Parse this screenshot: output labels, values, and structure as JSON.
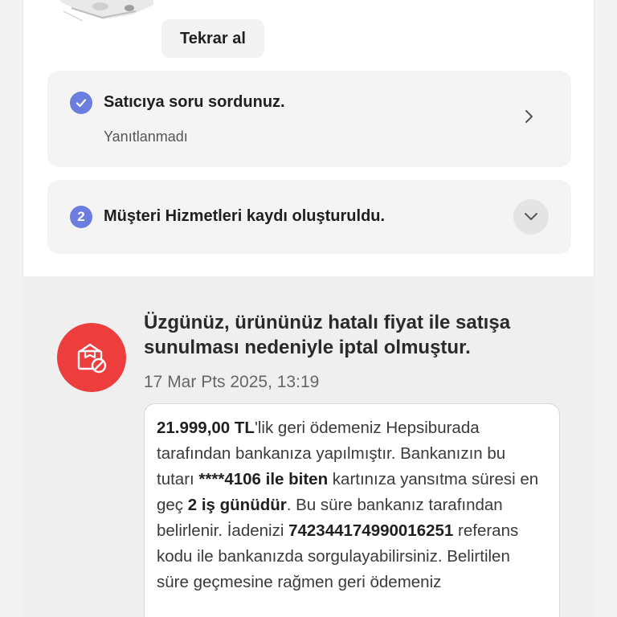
{
  "product": {
    "retake_label": "Tekrar al"
  },
  "steps": [
    {
      "badge": "✓",
      "title": "Satıcıya soru sordunuz.",
      "subtitle": "Yanıtlanmadı"
    },
    {
      "badge": "2",
      "title": "Müşteri Hizmetleri kaydı oluşturuldu."
    }
  ],
  "notice": {
    "title": "Üzgünüz, ürününüz hatalı fiyat ile satışa sunulması nedeniyle iptal olmuştur.",
    "date": "17 Mar Pts 2025, 13:19",
    "message": {
      "amount": "21.999,00 TL",
      "part1": "'lik geri ödemeniz Hepsiburada tarafından bankanıza yapılmıştır. Bankanızın bu tutarı ",
      "card": "****4106 ile biten",
      "part2": " kartınıza yansıtma süresi en geç ",
      "duration": "2 iş günüdür",
      "part3": ". Bu süre bankanız tarafından belirlenir. İadenizi ",
      "reference": "742344174990016251",
      "part4": " referans kodu ile bankanızda sorgulayabilirsiniz. Belirtilen süre geçmesine rağmen geri ödemeniz"
    }
  },
  "colors": {
    "badge": "#6c7de0",
    "cancel_icon_bg": "#ee3d3d"
  },
  "icons": {
    "step1": "check-icon",
    "step1_action": "chevron-right-icon",
    "step2_action": "chevron-down-icon",
    "notice": "cancelled-box-icon"
  }
}
